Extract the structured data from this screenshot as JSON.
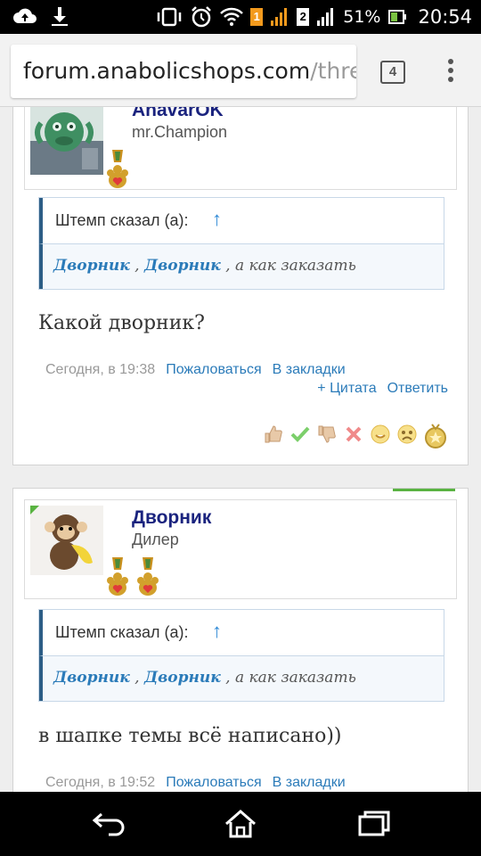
{
  "status_bar": {
    "sim1": "1",
    "sim2": "2",
    "battery": "51%",
    "time": "20:54"
  },
  "browser": {
    "url_host": "forum.anabolicshops.com",
    "url_path": "/thre",
    "tab_count": "4"
  },
  "posts": [
    {
      "username": "AnavarOK",
      "user_title": "mr.Champion",
      "quote": {
        "header": "Штемп сказал (а):",
        "arrow": "↑",
        "nick1": "Дворник",
        "sep1": " , ",
        "nick2": "Дворник",
        "rest": " , а как заказать"
      },
      "message": "Какой дворник?",
      "date": "Сегодня, в 19:38",
      "report": "Пожаловаться",
      "bookmark": "В закладки",
      "quote_action": "+ Цитата",
      "reply": "Ответить"
    },
    {
      "username": "Дворник",
      "user_title": "Дилер",
      "quote": {
        "header": "Штемп сказал (а):",
        "arrow": "↑",
        "nick1": "Дворник",
        "sep1": " , ",
        "nick2": "Дворник",
        "rest": " , а как заказать"
      },
      "message": "в шапке темы всё написано))",
      "date": "Сегодня, в 19:52",
      "report": "Пожаловаться",
      "bookmark": "В закладки"
    }
  ],
  "reactions": [
    "thumbs-up",
    "check",
    "thumbs-down",
    "cross",
    "smile",
    "sad",
    "medal"
  ],
  "colors": {
    "username": "#1a237e",
    "link": "#2b7bb9",
    "quote_border": "#2d5e86",
    "online": "#59b341"
  }
}
